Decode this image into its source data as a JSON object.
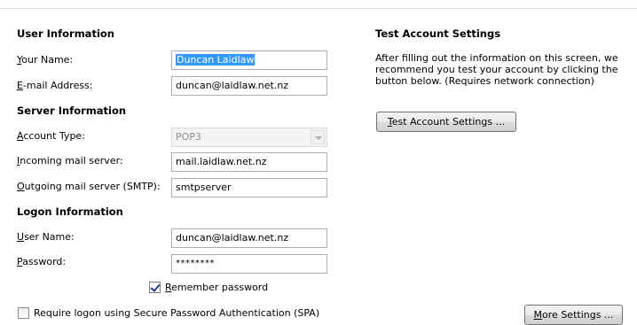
{
  "user_information": {
    "title": "User Information",
    "your_name_label_access": "Y",
    "your_name_label_rest": "our Name:",
    "your_name_value": "Duncan Laidlaw",
    "email_label_access": "E",
    "email_label_rest": "-mail Address:",
    "email_value": "duncan@laidlaw.net.nz"
  },
  "server_information": {
    "title": "Server Information",
    "account_type_label_access": "A",
    "account_type_label_rest": "ccount Type:",
    "account_type_value": "POP3",
    "incoming_label_access": "I",
    "incoming_label_rest": "ncoming mail server:",
    "incoming_value": "mail.laidlaw.net.nz",
    "outgoing_label_access": "O",
    "outgoing_label_rest": "utgoing mail server (SMTP):",
    "outgoing_value": "smtpserver"
  },
  "logon_information": {
    "title": "Logon Information",
    "username_label_access": "U",
    "username_label_rest": "ser Name:",
    "username_value": "duncan@laidlaw.net.nz",
    "password_label_access": "P",
    "password_label_rest": "assword:",
    "password_value": "********",
    "remember_access": "R",
    "remember_rest": "emember password",
    "remember_checked": true,
    "spa_label": "Require logon using Secure Password Authentication (SPA)",
    "spa_checked": false
  },
  "test_settings": {
    "title": "Test Account Settings",
    "description": "After filling out the information on this screen, we recommend you test your account by clicking the button below. (Requires network connection)",
    "button_access": "T",
    "button_rest": "est Account Settings ...",
    "more_settings_access": "M",
    "more_settings_rest": "ore Settings ..."
  }
}
